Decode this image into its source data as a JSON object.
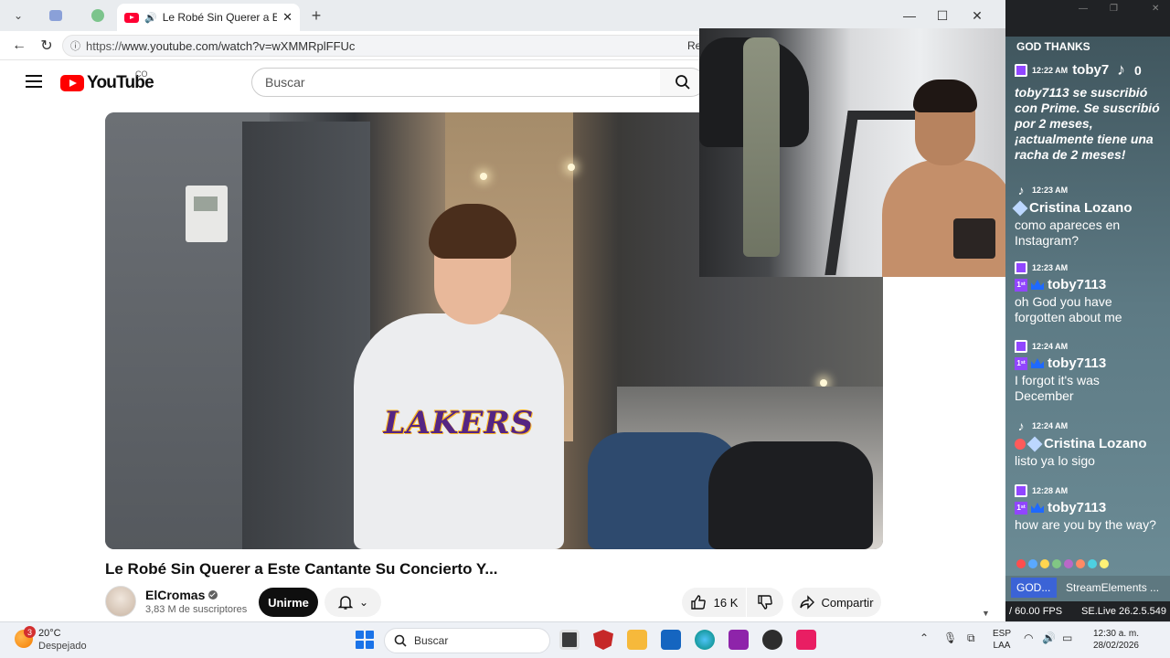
{
  "browser": {
    "tabs": {
      "active_title": "Le Robé Sin Querer a Este Can"
    },
    "url_prefix": "https://",
    "url": "www.youtube.com/watch?v=wXMMRplFFUc",
    "reader_label": "Re"
  },
  "youtube": {
    "logo_text": "YouTube",
    "country_code": "CO",
    "search_placeholder": "Buscar",
    "video_title": "Le Robé Sin Querer a Este Cantante Su Concierto Y...",
    "overlay_text": "LAKERS",
    "channel": {
      "name": "ElCromas",
      "subscribers": "3,83 M de suscriptores"
    },
    "join_label": "Unirme",
    "likes": "16 K",
    "share_label": "Compartir"
  },
  "overlay": {
    "chat_title": "GOD THANKS",
    "tiktok_count": "0",
    "messages": [
      {
        "platform": "twitch",
        "time": "12:22 AM",
        "user": "toby7",
        "badges": [],
        "text": "toby7113 se suscribió con Prime. Se suscribió por 2 meses, ¡actualmente tiene una racha de 2 meses!",
        "italic": true
      },
      {
        "platform": "tiktok",
        "time": "12:23 AM",
        "user": "Cristina Lozano",
        "badges": [
          "gem"
        ],
        "text": "como apareces en Instagram?",
        "italic": false
      },
      {
        "platform": "twitch",
        "time": "12:23 AM",
        "user": "toby7113",
        "badges": [
          "sub",
          "prime"
        ],
        "text": "oh God you have forgotten about me",
        "italic": false
      },
      {
        "platform": "twitch",
        "time": "12:24 AM",
        "user": "toby7113",
        "badges": [
          "sub",
          "prime"
        ],
        "text": "I forgot it's was December",
        "italic": false
      },
      {
        "platform": "tiktok",
        "time": "12:24 AM",
        "user": "Cristina Lozano",
        "badges": [
          "red",
          "gem"
        ],
        "text": "listo ya lo sigo",
        "italic": false
      },
      {
        "platform": "twitch",
        "time": "12:28 AM",
        "user": "toby7113",
        "badges": [
          "sub",
          "prime"
        ],
        "text": "how are you by the way?",
        "italic": false
      }
    ],
    "tabs": [
      "GOD...",
      "StreamElements ..."
    ],
    "fps": "/ 60.00 FPS",
    "version": "SE.Live 26.2.5.549"
  },
  "taskbar": {
    "temperature": "20°C",
    "weather": "Despejado",
    "weather_badge": "3",
    "search_placeholder": "Buscar",
    "lang_line1": "ESP",
    "lang_line2": "LAA",
    "time": "12:30 a. m.",
    "date": "28/02/2026"
  }
}
